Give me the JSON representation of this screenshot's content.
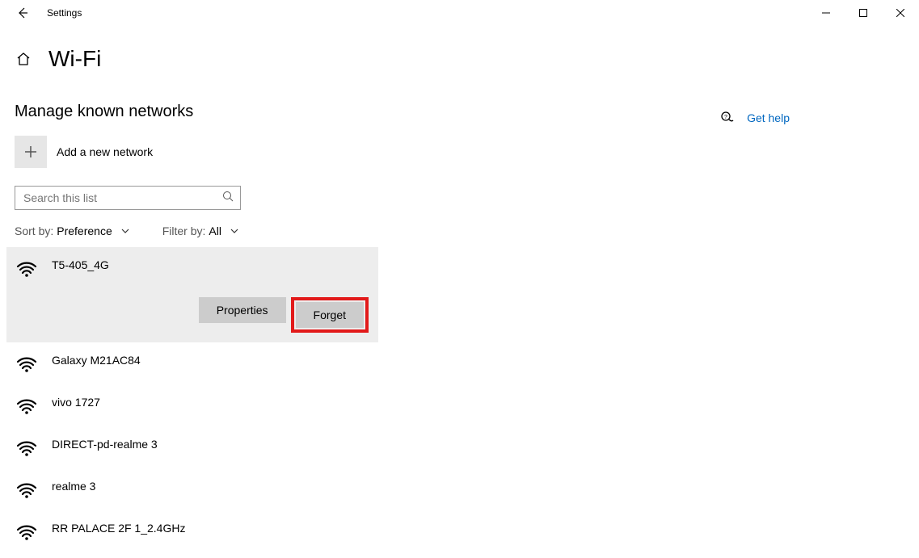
{
  "window": {
    "app_title": "Settings"
  },
  "page": {
    "title": "Wi-Fi",
    "subheader": "Manage known networks"
  },
  "add_network": {
    "label": "Add a new network"
  },
  "search": {
    "placeholder": "Search this list"
  },
  "sort": {
    "label": "Sort by:",
    "value": "Preference"
  },
  "filter": {
    "label": "Filter by:",
    "value": "All"
  },
  "actions": {
    "properties": "Properties",
    "forget": "Forget"
  },
  "help": {
    "label": "Get help"
  },
  "networks": [
    {
      "name": "T5-405_4G",
      "selected": true
    },
    {
      "name": "Galaxy M21AC84",
      "selected": false
    },
    {
      "name": "vivo 1727",
      "selected": false
    },
    {
      "name": "DIRECT-pd-realme 3",
      "selected": false
    },
    {
      "name": "realme 3",
      "selected": false
    },
    {
      "name": "RR PALACE 2F 1_2.4GHz",
      "selected": false
    }
  ]
}
